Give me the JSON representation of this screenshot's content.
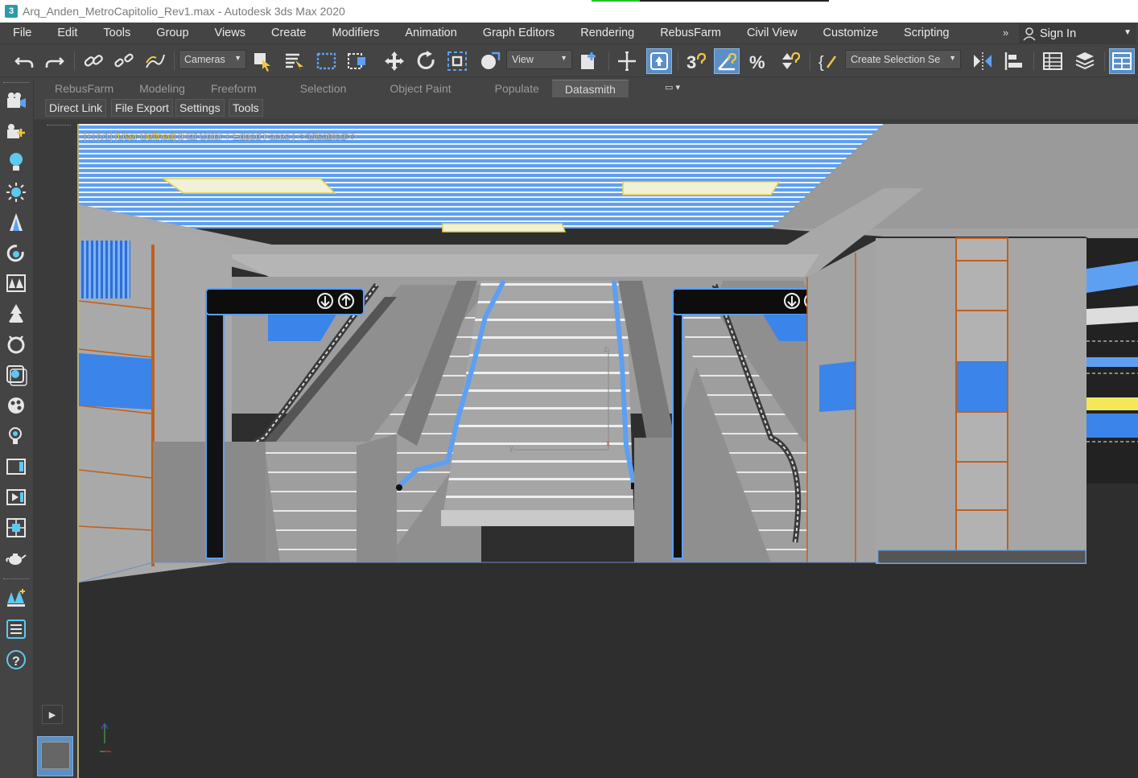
{
  "window": {
    "title": "Arq_Anden_MetroCapitolio_Rev1.max - Autodesk 3ds Max 2020",
    "app_icon": "3"
  },
  "menu": {
    "items": [
      "File",
      "Edit",
      "Tools",
      "Group",
      "Views",
      "Create",
      "Modifiers",
      "Animation",
      "Graph Editors",
      "Rendering",
      "RebusFarm",
      "Civil View",
      "Customize",
      "Scripting"
    ],
    "overflow": "»",
    "sign_in": "Sign In"
  },
  "toolbar": {
    "selection_filter": "Cameras",
    "reference_coord": "View",
    "named_selection": "Create Selection Se"
  },
  "ribbon": {
    "tabs": [
      "RebusFarm",
      "Modeling",
      "Freeform",
      "Selection",
      "Object Paint",
      "Populate",
      "Datasmith"
    ],
    "active_tab": "Datasmith",
    "panel_buttons": [
      "Direct Link",
      "File Export",
      "Settings",
      "Tools"
    ]
  },
  "viewport": {
    "label_prefix": "[+] [v1] [",
    "label_highlight": "User Defined",
    "label_mid": "] [Flat Color + Edged Faces ]",
    "label_suffix": "<<Disabled>>",
    "axis_x": "x",
    "axis_y": "y",
    "axis_z": "z"
  },
  "colors": {
    "accent_blue": "#5b8fc6",
    "ceiling_blue": "#5da0f2",
    "wall_grey": "#9b9b9b",
    "trim_orange": "#c0601e"
  }
}
